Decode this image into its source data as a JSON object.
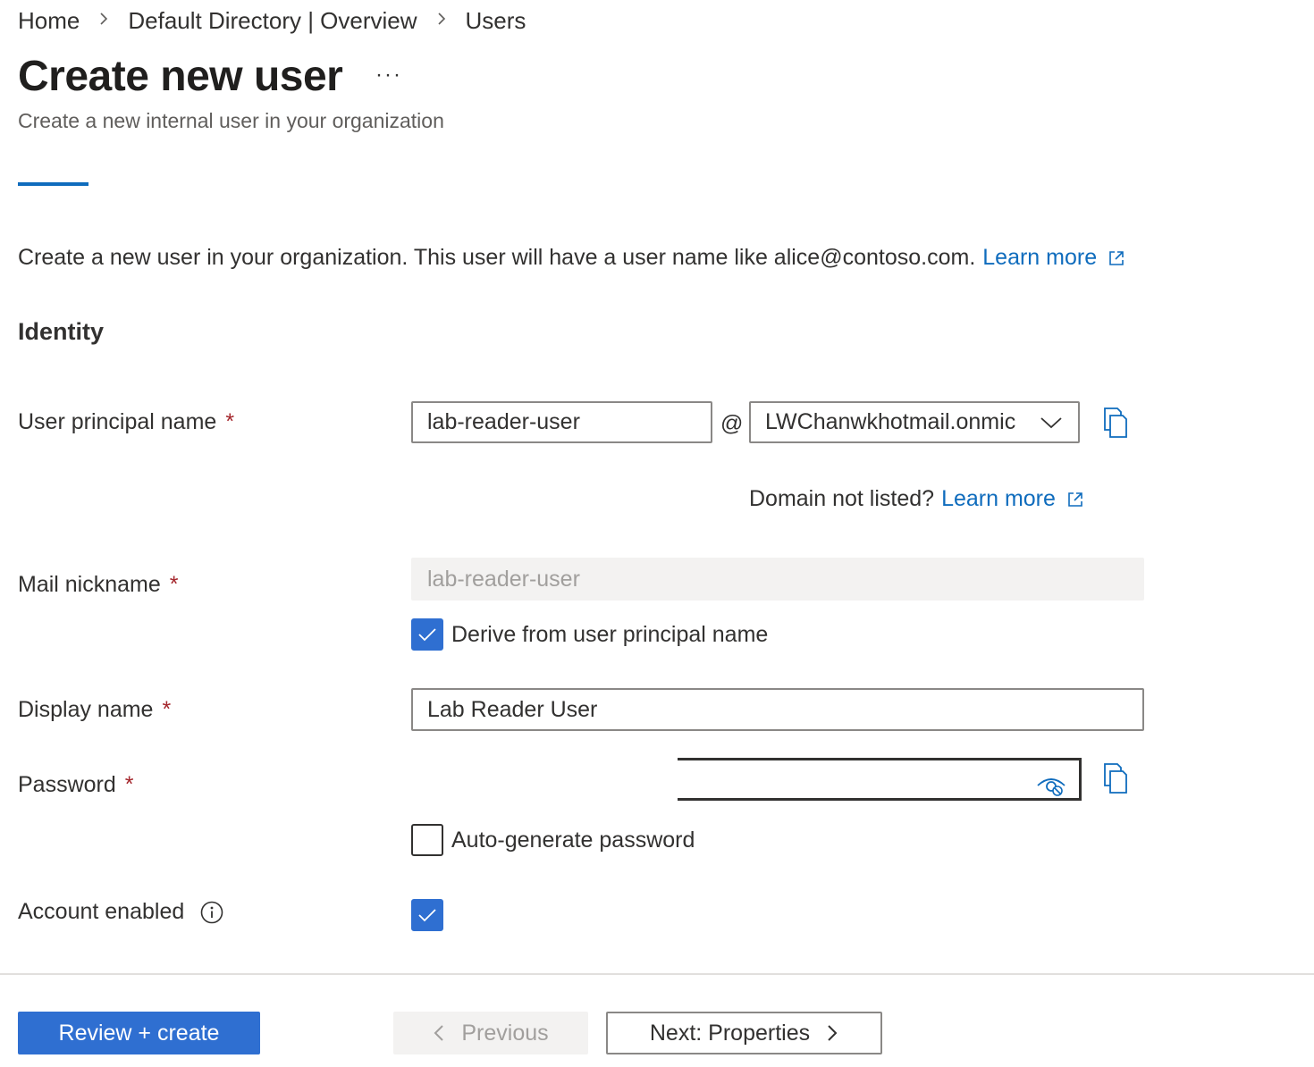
{
  "breadcrumb": {
    "items": [
      "Home",
      "Default Directory | Overview",
      "Users"
    ]
  },
  "header": {
    "title": "Create new user",
    "more": "···",
    "subtitle": "Create a new internal user in your organization"
  },
  "intro": {
    "text": "Create a new user in your organization. This user will have a user name like alice@contoso.com.",
    "link": "Learn more"
  },
  "identity": {
    "section_title": "Identity",
    "upn": {
      "label": "User principal name",
      "required_mark": "*",
      "value": "lab-reader-user",
      "at": "@",
      "domain": "LWChanwkhotmail.onmic"
    },
    "domain_note": {
      "text": "Domain not listed?",
      "link": "Learn more"
    },
    "mail_nickname": {
      "label": "Mail nickname",
      "required_mark": "*",
      "value": "lab-reader-user",
      "derive_label": "Derive from user principal name",
      "derive_checked": true
    },
    "display_name": {
      "label": "Display name",
      "required_mark": "*",
      "value": "Lab Reader User"
    },
    "password": {
      "label": "Password",
      "required_mark": "*",
      "value": "",
      "auto_generate_label": "Auto-generate password",
      "auto_generate_checked": false
    },
    "account_enabled": {
      "label": "Account enabled",
      "checked": true
    }
  },
  "footer": {
    "review_create": "Review + create",
    "previous": "Previous",
    "next": "Next: Properties"
  },
  "icons": {
    "breadcrumb_separator": "chevron-right-icon",
    "external_link": "external-link-icon",
    "dropdown": "chevron-down-icon",
    "copy": "copy-icon",
    "checkmark": "checkmark-icon",
    "reveal_password": "eye-hidden-icon",
    "info": "info-icon"
  },
  "colors": {
    "accent": "#0f6cbd",
    "checkbox": "#2f6fd1",
    "required": "#a4262c",
    "text": "#323130",
    "disabled_bg": "#f3f2f1"
  }
}
